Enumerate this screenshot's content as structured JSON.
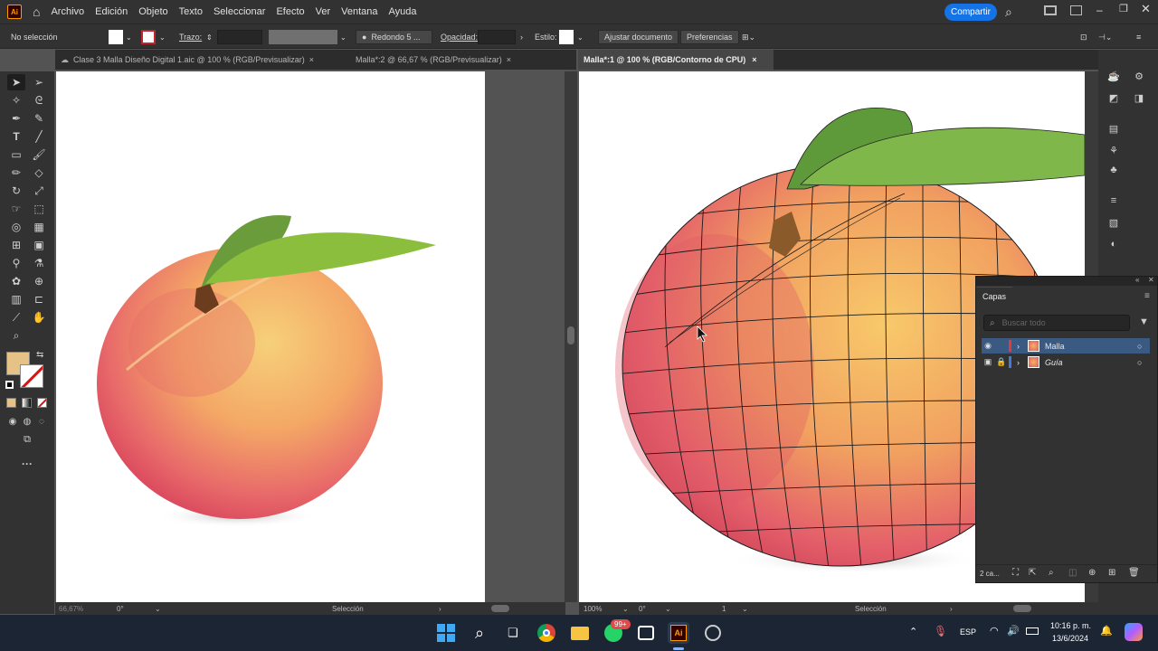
{
  "menubar": {
    "app_logo": "Ai",
    "items": [
      "Archivo",
      "Edición",
      "Objeto",
      "Texto",
      "Seleccionar",
      "Efecto",
      "Ver",
      "Ventana",
      "Ayuda"
    ],
    "share_label": "Compartir"
  },
  "control_bar": {
    "selection_label": "No selección",
    "stroke_label": "Trazo:",
    "brush_label": "Redondo 5 ...",
    "opacity_label": "Opacidad:",
    "style_label": "Estilo:",
    "fit_document_label": "Ajustar documento",
    "preferences_label": "Preferencias"
  },
  "tabs_left": [
    {
      "label": "Clase 3 Malla Diseño Digital 1.aic @ 100 % (RGB/Previsualizar)",
      "close": "×"
    },
    {
      "label": "Malla*:2 @ 66,67 % (RGB/Previsualizar)",
      "close": "×"
    }
  ],
  "tabs_right": [
    {
      "label": "Malla*:1 @ 100 % (RGB/Contorno de CPU)",
      "close": "×"
    }
  ],
  "status_left": {
    "zoom": "66,67%",
    "rotation": "0°",
    "mode": "Selección"
  },
  "status_right": {
    "zoom": "100%",
    "rotation": "0°",
    "artboard": "1",
    "mode": "Selección"
  },
  "layers_panel": {
    "title": "Capas",
    "search_placeholder": "Buscar todo",
    "layers": [
      {
        "name": "Malla",
        "color": "#e23b3b",
        "selected": true
      },
      {
        "name": "Guía",
        "color": "#4a78d8",
        "selected": false
      }
    ],
    "count_label": "2 ca..."
  },
  "taskbar": {
    "whatsapp_badge": "99+",
    "language": "ESP",
    "time": "10:16 p. m.",
    "date": "13/6/2024"
  },
  "colors": {
    "fill_swatch": "#e6c287",
    "accent_blue": "#1473e6"
  }
}
